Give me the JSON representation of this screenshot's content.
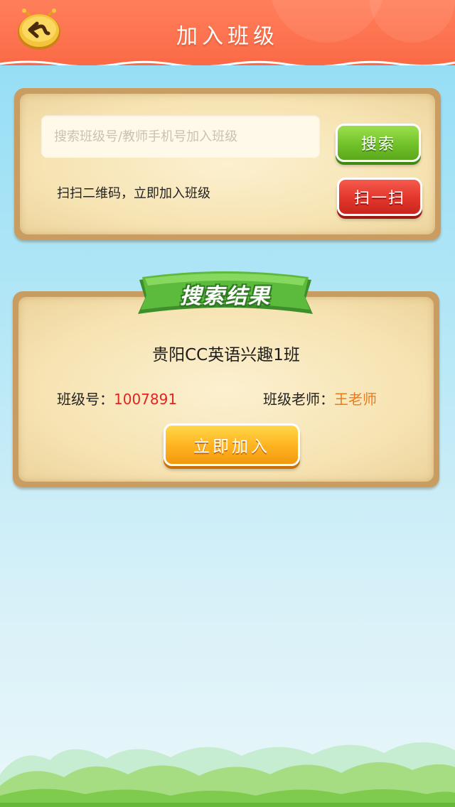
{
  "header": {
    "title": "加入班级",
    "back_icon": "back-arrow-icon"
  },
  "search": {
    "placeholder": "搜索班级号/教师手机号加入班级",
    "value": "",
    "search_button": "搜索",
    "scan_hint": "扫扫二维码，立即加入班级",
    "scan_button": "扫一扫"
  },
  "result": {
    "ribbon_label": "搜索结果",
    "class_name": "贵阳CC英语兴趣1班",
    "class_id_label": "班级号：",
    "class_id_value": "1007891",
    "teacher_label": "班级老师：",
    "teacher_value": "王老师",
    "join_button": "立即加入"
  },
  "colors": {
    "header": "#fb6a47",
    "search_button": "#72c22a",
    "scan_button": "#e2362b",
    "join_button": "#ffb522",
    "class_id_value": "#e52222",
    "teacher_value": "#f07a16",
    "ribbon": "#5cba3c"
  }
}
